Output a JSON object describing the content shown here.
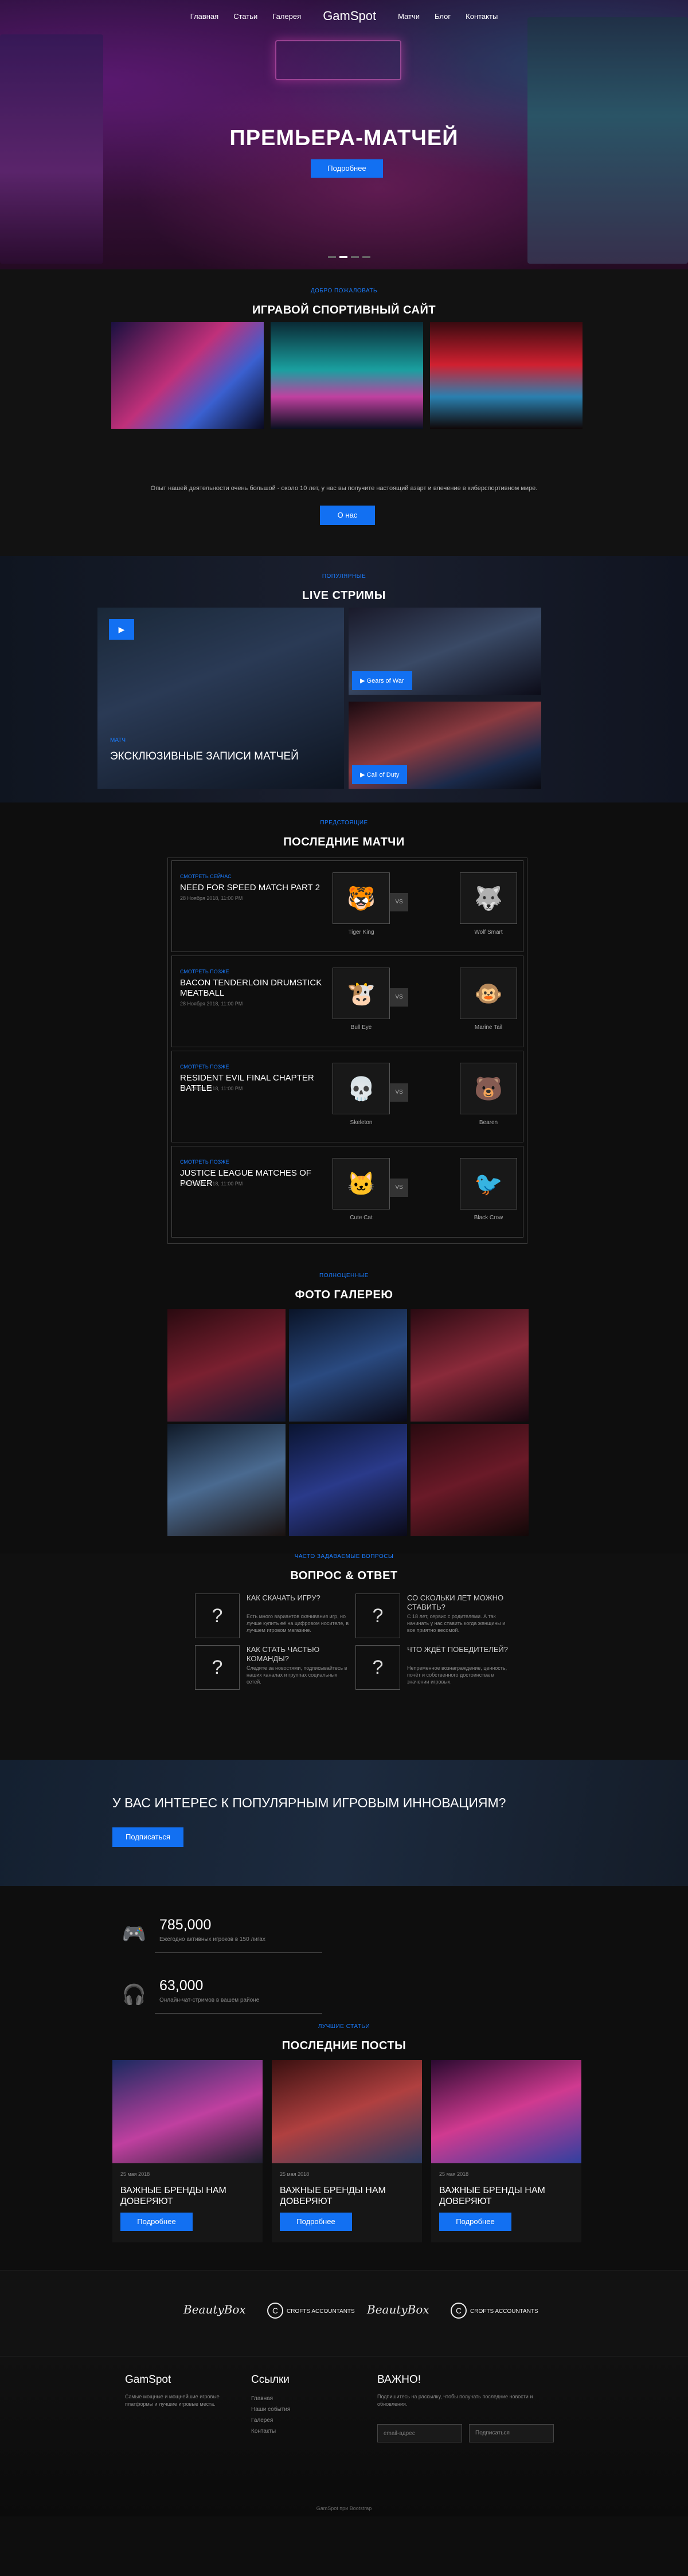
{
  "nav": {
    "items": [
      "Главная",
      "Статьи",
      "Галерея"
    ],
    "logo": "GamSpot",
    "items_right": [
      "Матчи",
      "Блог",
      "Контакты"
    ]
  },
  "hero": {
    "title": "ПРЕМЬЕРА-МАТЧЕЙ",
    "button": "Подробнее",
    "slides": 4,
    "active_slide": 2
  },
  "about": {
    "sub": "ДОБРО ПОЖАЛОВАТЬ",
    "title": "ИГРАВОЙ СПОРТИВНЫЙ САЙТ",
    "text": "Опыт нашей деятельности очень большой - около 10 лет, у нас вы получите настоящий азарт и влечение в киберспортивном мире.",
    "button": "О нас"
  },
  "live": {
    "sub": "ПОПУЛЯРНЫЕ",
    "title": "LIVE СТРИМЫ",
    "big_sub": "МАТЧ",
    "big_title": "ЭКСКЛЮЗИВНЫЕ ЗАПИСИ МАТЧЕЙ",
    "play": "▶",
    "tag1": "▶ Gears of War",
    "tag2": "▶ Call of Duty"
  },
  "matches": {
    "sub": "ПРЕДСТОЯЩИЕ",
    "title": "ПОСЛЕДНИЕ МАТЧИ",
    "vs": "VS",
    "rows": [
      {
        "label": "СМОТРЕТЬ СЕЙЧАС",
        "title": "NEED FOR SPEED MATCH PART 2",
        "date": "28 Ноября 2018, 11:00 PM",
        "t1": "Tiger King",
        "t2": "Wolf Smart",
        "i1": "🐯",
        "i2": "🐺"
      },
      {
        "label": "СМОТРЕТЬ ПОЗЖЕ",
        "title": "BACON TENDERLOIN DRUMSTICK MEATBALL",
        "date": "28 Ноября 2018, 11:00 PM",
        "t1": "Bull Eye",
        "t2": "Marine Tail",
        "i1": "🐮",
        "i2": "🐵"
      },
      {
        "label": "СМОТРЕТЬ ПОЗЖЕ",
        "title": "RESIDENT EVIL FINAL CHAPTER BATTLE",
        "date": "28 Ноября 2018, 11:00 PM",
        "t1": "Skeleton",
        "t2": "Bearen",
        "i1": "💀",
        "i2": "🐻"
      },
      {
        "label": "СМОТРЕТЬ ПОЗЖЕ",
        "title": "JUSTICE LEAGUE MATCHES OF POWER",
        "date": "28 Ноября 2018, 11:00 PM",
        "t1": "Cute Cat",
        "t2": "Black Crow",
        "i1": "🐱",
        "i2": "🐦"
      }
    ]
  },
  "gallery": {
    "sub": "ПОЛНОЦЕННЫЕ",
    "title": "ФОТО ГАЛЕРЕЮ"
  },
  "faq": {
    "sub": "ЧАСТО ЗАДАВАЕМЫЕ ВОПРОСЫ",
    "title": "ВОПРОС & ОТВЕТ",
    "items": [
      {
        "q": "КАК СКАЧАТЬ ИГРУ?",
        "a": "Есть много вариантов скачивания игр, но лучше купить её на цифровом носителе, в лучшем игровом магазине."
      },
      {
        "q": "СО СКОЛЬКИ ЛЕТ МОЖНО СТАВИТЬ?",
        "a": "С 18 лет, сервис с родителями. А так начинать у нас ставить когда женщины и все приятно весомой."
      },
      {
        "q": "КАК СТАТЬ ЧАСТЬЮ КОМАНДЫ?",
        "a": "Следите за новостями, подписывайтесь в наших каналах и группах социальных сетей."
      },
      {
        "q": "ЧТО ЖДЁТ ПОБЕДИТЕЛЕЙ?",
        "a": "Непременное вознаграждение, ценность, почёт и собственного достоинства в значении игровых."
      }
    ]
  },
  "banner": {
    "title": "У ВАС ИНТЕРЕС К ПОПУЛЯРНЫМ ИГРОВЫМ ИННОВАЦИЯМ?",
    "button": "Подписаться"
  },
  "stats": [
    {
      "num": "785,000",
      "desc": "Ежегодно активных игроков в 150 лигах"
    },
    {
      "num": "63,000",
      "desc": "Онлайн-чат-стримов в вашем районе"
    }
  ],
  "posts": {
    "sub": "ЛУЧШИЕ СТАТЬИ",
    "title": "ПОСЛЕДНИЕ ПОСТЫ",
    "items": [
      {
        "date": "25 мая 2018",
        "title": "ВАЖНЫЕ БРЕНДЫ НАМ ДОВЕРЯЮТ",
        "button": "Подробнее"
      },
      {
        "date": "25 мая 2018",
        "title": "ВАЖНЫЕ БРЕНДЫ НАМ ДОВЕРЯЮТ",
        "button": "Подробнее"
      },
      {
        "date": "25 мая 2018",
        "title": "ВАЖНЫЕ БРЕНДЫ НАМ ДОВЕРЯЮТ",
        "button": "Подробнее"
      }
    ]
  },
  "partners": [
    "BeautyBox",
    "CROFTS ACCOUNTANTS",
    "BeautyBox",
    "CROFTS ACCOUNTANTS"
  ],
  "footer": {
    "c1_title": "GamSpot",
    "c1_text": "Самые мощные и мощнейшие игровые платформы и лучшие игровые места.",
    "c2_title": "Ссылки",
    "links": [
      "Главная",
      "Наши события",
      "Галерея",
      "Контакты"
    ],
    "c3_title": "ВАЖНО!",
    "c3_text": "Подпишитесь на рассылку, чтобы получать последние новости и обновления.",
    "email_ph": "email-адрес",
    "btn": "Подписаться",
    "copyright": "GamSpot при Bootstrap"
  }
}
